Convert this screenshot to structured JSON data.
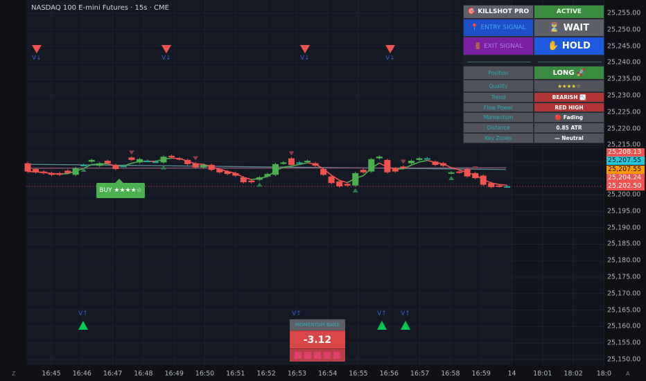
{
  "header": {
    "title": "NASDAQ 100 E-mini Futures · 15s · CME"
  },
  "price_axis": {
    "labels": [
      "25,255.00",
      "25,250.00",
      "25,245.00",
      "25,240.00",
      "25,235.00",
      "25,230.00",
      "25,225.00",
      "25,220.00",
      "25,215.00",
      "25,210.00",
      "25,205.00",
      "25,200.00",
      "25,195.00",
      "25,190.00",
      "25,185.00",
      "25,180.00",
      "25,175.00",
      "25,170.00",
      "25,165.00",
      "25,160.00",
      "25,155.00",
      "25,150.00"
    ],
    "tags": [
      {
        "text": "25,208.13",
        "color": "#f05350",
        "price": 25208.13
      },
      {
        "text": "25,207.55",
        "color": "#26c6da",
        "price": 25207.55,
        "dark": true
      },
      {
        "text": "25,207.55",
        "color": "#ff9800",
        "price": 25207.55,
        "dark": true
      },
      {
        "text": "25,204.24",
        "color": "#f05350",
        "price": 25204.24
      },
      {
        "text": "25,202.50",
        "color": "#f05350",
        "price": 25202.5
      }
    ]
  },
  "time_axis": {
    "labels": [
      "16:45",
      "16:46",
      "16:47",
      "16:48",
      "16:49",
      "16:50",
      "16:51",
      "16:52",
      "16:53",
      "16:54",
      "16:55",
      "16:56",
      "16:57",
      "16:58",
      "16:59",
      "14",
      "18:01",
      "18:02",
      "18:0"
    ],
    "left_corner": "Z",
    "right_corner": "A"
  },
  "panel": {
    "title": "🎯 KILLSHOT PRO",
    "status": "ACTIVE",
    "entry_label": "📍 ENTRY SIGNAL",
    "entry_value": "⏳ WAIT",
    "exit_label": "🚪 EXIT SIGNAL",
    "exit_value": "✋ HOLD",
    "rows": [
      {
        "label": "Position",
        "value": "LONG 🚀",
        "bg": "#3a8a3f"
      },
      {
        "label": "Quality",
        "value": "★★★★☆",
        "bg": "#50535b",
        "color": "#f5d142"
      },
      {
        "label": "Trend",
        "value": "BEARISH 📉",
        "bg": "#b23535"
      },
      {
        "label": "Flow Power",
        "value": "RED HIGH",
        "bg": "#b23535"
      },
      {
        "label": "Momentum",
        "value": "🔴 Fading",
        "bg": "#50535b"
      },
      {
        "label": "Distance",
        "value": "0.85 ATR",
        "bg": "#50535b"
      },
      {
        "label": "Key Zones",
        "value": "— Neutral",
        "bg": "#50535b"
      }
    ]
  },
  "buy_label": "BUY ★★★★☆",
  "momentum": {
    "title": "MOMENTUM BARS",
    "value": "-3.12",
    "bars": 5
  },
  "signals": {
    "down_label": "V↓",
    "up_label": "V↑"
  },
  "colors": {
    "up": "#4caf50",
    "down": "#f05350",
    "teal": "#26a69a"
  },
  "chart_data": {
    "type": "candlestick",
    "ylim": [
      25150,
      25255
    ],
    "candles": [
      [
        25209.5,
        25207.0
      ],
      [
        25207.75,
        25206.75
      ],
      [
        25207.0,
        25206.5
      ],
      [
        25206.5,
        25206.0
      ],
      [
        25206.5,
        25206.0
      ],
      [
        25207.25,
        25206.5
      ],
      [
        25206.0,
        25208.0
      ],
      [
        25209.0,
        25209.0
      ],
      [
        25210.0,
        25210.5
      ],
      [
        25208.75,
        25209.5
      ],
      [
        25210.25,
        25209.5
      ],
      [
        25209.0,
        25207.75
      ],
      [
        25208.75,
        25208.75
      ],
      [
        25211.25,
        25210.5
      ],
      [
        25209.75,
        25210.75
      ],
      [
        25210.25,
        25210.25
      ],
      [
        25210.0,
        25210.0
      ],
      [
        25209.75,
        25211.5
      ],
      [
        25211.75,
        25211.5
      ],
      [
        25211.0,
        25210.75
      ],
      [
        25210.5,
        25209.25
      ],
      [
        25209.5,
        25208.25
      ],
      [
        25208.25,
        25209.0
      ],
      [
        25209.0,
        25207.5
      ],
      [
        25207.75,
        25206.75
      ],
      [
        25207.0,
        25206.25
      ],
      [
        25206.5,
        25205.75
      ],
      [
        25205.25,
        25203.75
      ],
      [
        25204.25,
        25203.75
      ],
      [
        25204.5,
        25205.25
      ],
      [
        25205.5,
        25206.25
      ],
      [
        25206.0,
        25209.25
      ],
      [
        25209.5,
        25209.75
      ],
      [
        25211.0,
        25209.0
      ],
      [
        25209.75,
        25209.75
      ],
      [
        25210.0,
        25210.25
      ],
      [
        25209.5,
        25208.75
      ],
      [
        25207.75,
        25206.0
      ],
      [
        25205.5,
        25203.5
      ],
      [
        25204.0,
        25202.5
      ],
      [
        25203.25,
        25202.75
      ],
      [
        25202.75,
        25206.5
      ],
      [
        25207.5,
        25206.75
      ],
      [
        25207.0,
        25210.75
      ],
      [
        25211.0,
        25211.5
      ],
      [
        25210.5,
        25206.75
      ],
      [
        25208.0,
        25207.0
      ],
      [
        25208.5,
        25208.0
      ],
      [
        25209.5,
        25210.25
      ],
      [
        25210.5,
        25211.0
      ],
      [
        25211.0,
        25211.0
      ],
      [
        25210.0,
        25209.0
      ],
      [
        25209.5,
        25208.75
      ],
      [
        25206.5,
        25206.75
      ],
      [
        25207.0,
        25206.75
      ],
      [
        25207.75,
        25205.5
      ],
      [
        25206.5,
        25205.0
      ],
      [
        25205.75,
        25203.0
      ],
      [
        25203.5,
        25202.25
      ],
      [
        25202.75,
        25202.5
      ],
      [
        25202.5,
        25202.5
      ]
    ],
    "small_down_markers": [
      13,
      21,
      33,
      47,
      56
    ],
    "small_up_markers": [
      7,
      17,
      29,
      41,
      53
    ],
    "big_down_markers": [
      1,
      18,
      35,
      46
    ],
    "big_up_markers": [
      7,
      34,
      45,
      48
    ],
    "ma_lines": [
      {
        "start": 25209.2,
        "end": 25207.6,
        "color": "#5a8a96"
      },
      {
        "start": 25208.0,
        "end": 25208.1,
        "color": "#8a5a78"
      }
    ],
    "last_price_line": 25202.5
  }
}
